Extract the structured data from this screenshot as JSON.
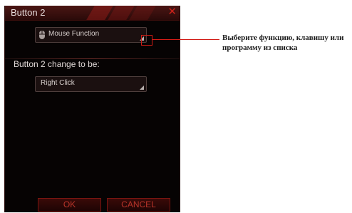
{
  "window": {
    "title": "Button 2"
  },
  "function_select": {
    "value": "Mouse Function",
    "icon": "mouse-icon"
  },
  "change_label": "Button 2 change to be:",
  "change_select": {
    "value": "Right Click"
  },
  "buttons": {
    "ok": "OK",
    "cancel": "CANCEL"
  },
  "callout": {
    "text": "Выберите функцию, клавишу или программу из списка"
  },
  "colors": {
    "accent": "#c9221a",
    "background": "#060303",
    "callout": "#d21c15"
  }
}
